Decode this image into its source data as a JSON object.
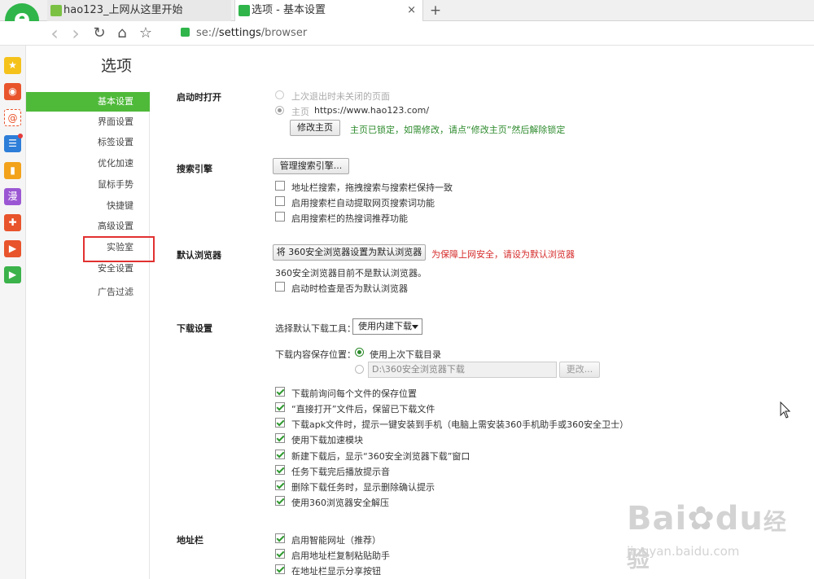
{
  "tabs": [
    {
      "title": "hao123_上网从这里开始",
      "close": "×"
    },
    {
      "title": "选项 - 基本设置",
      "close": "×"
    }
  ],
  "new_tab": "+",
  "nav": {
    "back": "‹",
    "forward": "›",
    "reload": "↻",
    "home": "⌂",
    "star": "☆",
    "url_scheme": "se://",
    "url_host": "settings",
    "url_path": "/browser"
  },
  "brand": {
    "logo_letter": "e",
    "accent": "#4fba3a"
  },
  "rail_icons": [
    "star-icon",
    "weibo-icon",
    "mail-icon",
    "news-icon",
    "book-icon",
    "comic-icon",
    "game-icon",
    "video-icon",
    "tv-icon"
  ],
  "page_title": "选项",
  "settings_nav": [
    {
      "label": "基本设置",
      "active": true
    },
    {
      "label": "界面设置"
    },
    {
      "label": "标签设置"
    },
    {
      "label": "优化加速"
    },
    {
      "label": "鼠标手势"
    },
    {
      "label": "快捷键"
    },
    {
      "label": "高级设置"
    },
    {
      "label": "实验室"
    },
    {
      "label": "安全设置"
    },
    {
      "label": "广告过滤"
    }
  ],
  "startup": {
    "title": "启动时打开",
    "opt_last": "上次退出时未关闭的页面",
    "opt_home_label": "主页",
    "home_url": "https://www.hao123.com/",
    "modify_btn": "修改主页",
    "locked_note": "主页已锁定，如需修改，请点“修改主页”然后解除锁定"
  },
  "search": {
    "title": "搜索引擎",
    "manage_btn": "管理搜索引擎...",
    "options": [
      "地址栏搜索，拖拽搜索与搜索栏保持一致",
      "启用搜索栏自动提取网页搜索词功能",
      "启用搜索栏的热搜词推荐功能"
    ]
  },
  "default_browser": {
    "title": "默认浏览器",
    "set_btn": "将 360安全浏览器设置为默认浏览器",
    "warning": "为保障上网安全，请设为默认浏览器",
    "status": "360安全浏览器目前不是默认浏览器。",
    "check_opt": "启动时检查是否为默认浏览器"
  },
  "download": {
    "title": "下载设置",
    "tool_label": "选择默认下载工具：",
    "tool_value": "使用内建下载",
    "save_label": "下载内容保存位置：",
    "save_last": "使用上次下载目录",
    "path_value": "D:\\360安全浏览器下载",
    "change_btn": "更改...",
    "options": [
      "下载前询问每个文件的保存位置",
      "“直接打开”文件后，保留已下载文件",
      "下载apk文件时，提示一键安装到手机（电脑上需安装360手机助手或360安全卫士）",
      "使用下载加速模块",
      "新建下载后，显示“360安全浏览器下载”窗口",
      "任务下载完后播放提示音",
      "删除下载任务时，显示删除确认提示",
      "使用360浏览器安全解压"
    ]
  },
  "addressbar": {
    "title": "地址栏",
    "options": [
      "启用智能网址（推荐）",
      "启用地址栏复制粘贴助手",
      "在地址栏显示分享按钮"
    ]
  },
  "watermark": {
    "brand": "Bai",
    "brand2": "du",
    "cn": "经验",
    "url": "jingyan.baidu.com"
  }
}
